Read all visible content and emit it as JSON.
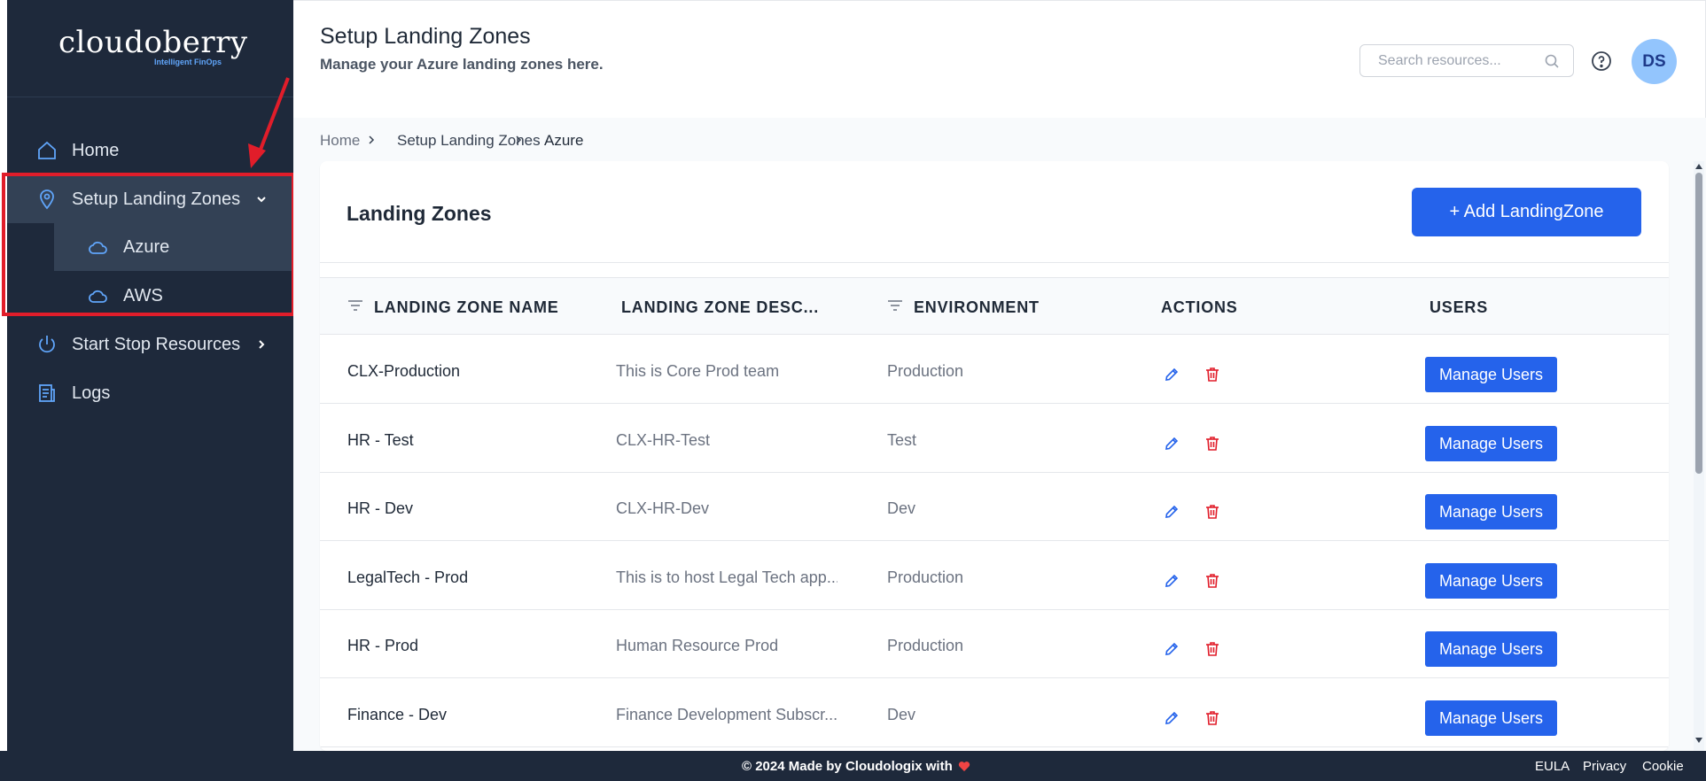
{
  "brand": {
    "name": "cloudoberry",
    "tagline": "Intelligent FinOps"
  },
  "sidebar": {
    "items": [
      {
        "label": "Home",
        "icon": "home-icon"
      },
      {
        "label": "Setup Landing Zones",
        "icon": "location-pin-icon",
        "expanded": true,
        "children": [
          {
            "label": "Azure",
            "icon": "cloud-icon",
            "active": true
          },
          {
            "label": "AWS",
            "icon": "cloud-icon"
          }
        ]
      },
      {
        "label": "Start Stop Resources",
        "icon": "power-icon"
      },
      {
        "label": "Logs",
        "icon": "document-icon"
      }
    ]
  },
  "header": {
    "title": "Setup Landing Zones",
    "subtitle": "Manage your Azure landing zones here.",
    "search_placeholder": "Search resources...",
    "avatar_initials": "DS"
  },
  "breadcrumb": [
    "Home",
    "Setup Landing Zones",
    "Azure"
  ],
  "card": {
    "title": "Landing Zones",
    "add_button": "+ Add LandingZone"
  },
  "table": {
    "columns": [
      "LANDING ZONE NAME",
      "LANDING ZONE DESC...",
      "ENVIRONMENT",
      "ACTIONS",
      "USERS"
    ],
    "manage_label": "Manage Users",
    "rows": [
      {
        "name": "CLX-Production",
        "desc": "This is Core Prod team",
        "env": "Production"
      },
      {
        "name": "HR - Test",
        "desc": "CLX-HR-Test",
        "env": "Test"
      },
      {
        "name": "HR - Dev",
        "desc": "CLX-HR-Dev",
        "env": "Dev"
      },
      {
        "name": "LegalTech - Prod",
        "desc": "This is to host Legal Tech app...",
        "env": "Production"
      },
      {
        "name": "HR - Prod",
        "desc": "Human Resource Prod",
        "env": "Production"
      },
      {
        "name": "Finance - Dev",
        "desc": "Finance Development Subscr...",
        "env": "Dev"
      }
    ]
  },
  "footer": {
    "copyright": "© 2024 Made by Cloudologix with",
    "links": [
      "EULA",
      "Privacy",
      "Cookie"
    ]
  },
  "colors": {
    "sidebar_bg": "#1e293b",
    "primary": "#2563eb",
    "danger": "#e11d2a",
    "annotation": "#e11d2a"
  }
}
